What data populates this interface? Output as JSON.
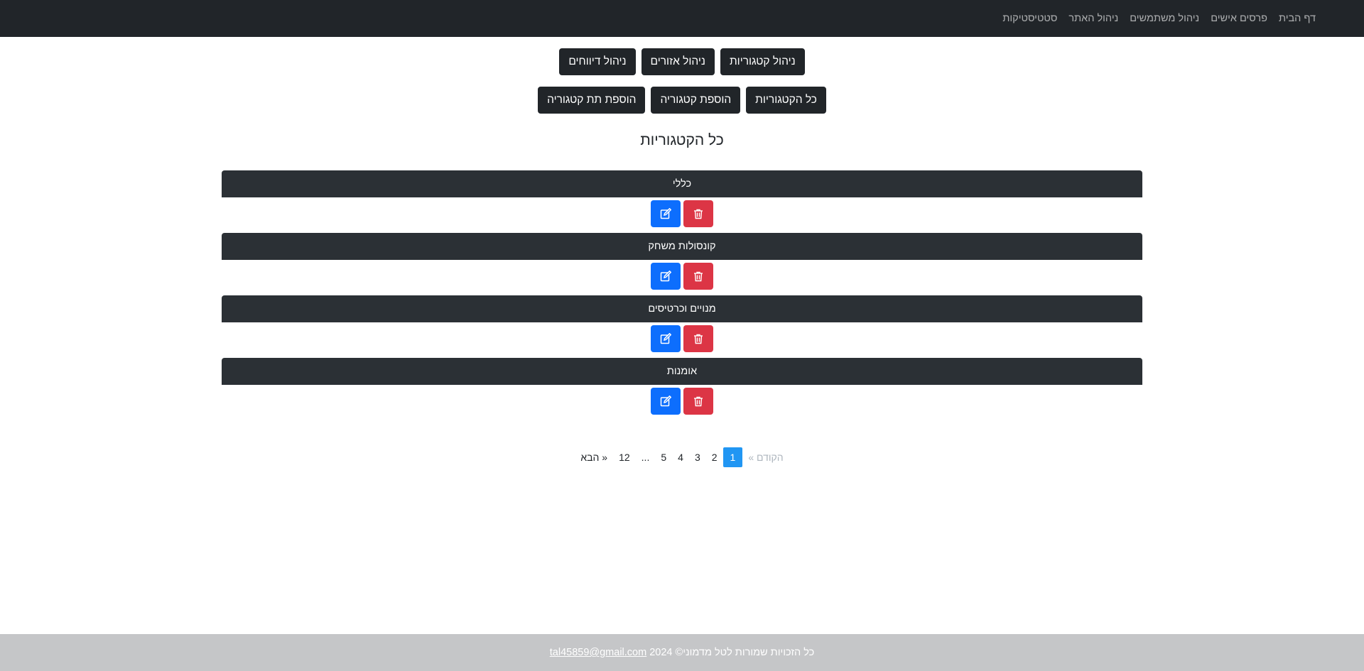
{
  "navbar": {
    "links": [
      "דף הבית",
      "פרסים אישים",
      "ניהול משתמשים",
      "ניהול האתר",
      "סטטיסטיקות"
    ]
  },
  "admin_buttons": {
    "row1": [
      "ניהול קטגוריות",
      "ניהול אזורים",
      "ניהול דיווחים"
    ],
    "row2": [
      "כל הקטגוריות",
      "הוספת קטגוריה",
      "הוספת תת קטגוריה"
    ]
  },
  "page_title": "כל הקטגוריות",
  "categories": [
    {
      "name": "כללי"
    },
    {
      "name": "קונסולות משחק"
    },
    {
      "name": "מנויים וכרטיסים"
    },
    {
      "name": "אומנות"
    }
  ],
  "actions": {
    "edit_icon": "edit-icon",
    "delete_icon": "trash-icon"
  },
  "pagination": {
    "prev": "« הקודם",
    "pages": [
      "1",
      "2",
      "3",
      "4",
      "5",
      "...",
      "12"
    ],
    "current": "1",
    "next": "הבא »"
  },
  "footer": {
    "text": "כל הזכויות שמורות לטל מדמוני© 2024",
    "email": "tal45859@gmail.com"
  },
  "colors": {
    "navbar_bg": "#212529",
    "edit": "#0d6efd",
    "delete": "#dc3545",
    "active_page": "#2196f3",
    "footer_bg": "#c5c6c8"
  }
}
